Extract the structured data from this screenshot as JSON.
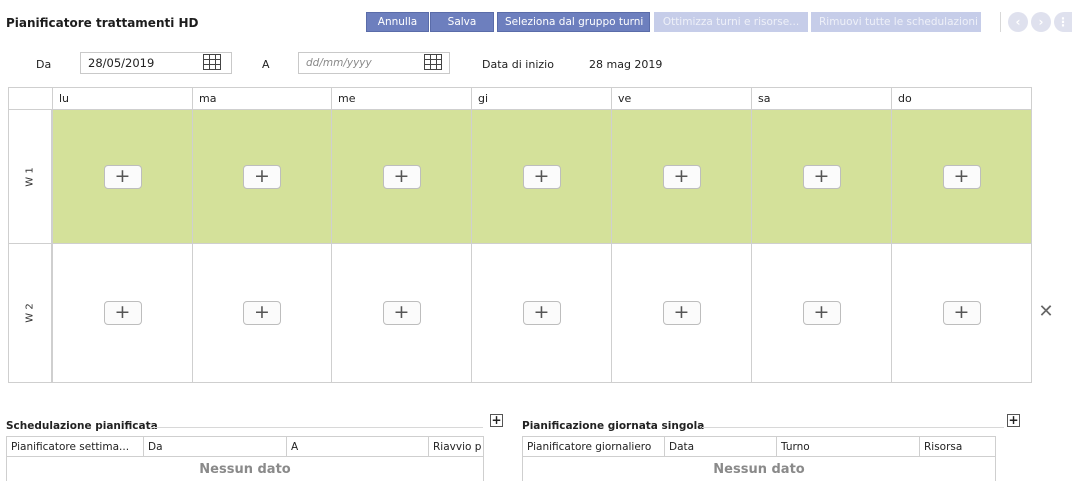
{
  "header": {
    "title": "Pianificatore trattamenti HD",
    "buttons": {
      "cancel": "Annulla",
      "save": "Salva",
      "select_group": "Seleziona dal gruppo turni",
      "optimize": "Ottimizza turni e risorse...",
      "remove_all": "Rimuovi tutte le schedulazioni"
    }
  },
  "date_filter": {
    "from_label": "Da",
    "from_value": "28/05/2019",
    "to_label": "A",
    "to_placeholder": "dd/mm/yyyy",
    "start_label": "Data di inizio",
    "start_value": "28 mag 2019"
  },
  "calendar": {
    "days": [
      "lu",
      "ma",
      "me",
      "gi",
      "ve",
      "sa",
      "do"
    ],
    "weeks": [
      "W 1",
      "W 2"
    ],
    "add_symbol": "+",
    "highlight_color": "#d4e19a"
  },
  "scheduled": {
    "title": "Schedulazione pianificata",
    "columns": [
      "Pianificatore settima...",
      "Da",
      "A",
      "Riavvio p"
    ],
    "empty": "Nessun dato"
  },
  "single_day": {
    "title": "Pianificazione giornata singola",
    "columns": [
      "Pianificatore giornaliero",
      "Data",
      "Turno",
      "Risorsa"
    ],
    "empty": "Nessun dato"
  },
  "icons": {
    "calendar": "calendar-icon",
    "prev": "chevron-left-icon",
    "next": "chevron-right-icon",
    "close": "close-icon",
    "add": "plus-icon"
  },
  "colors": {
    "primary_button": "#6d7fbe",
    "disabled_button": "#c6cde9",
    "week1_background": "#d4e19a"
  }
}
